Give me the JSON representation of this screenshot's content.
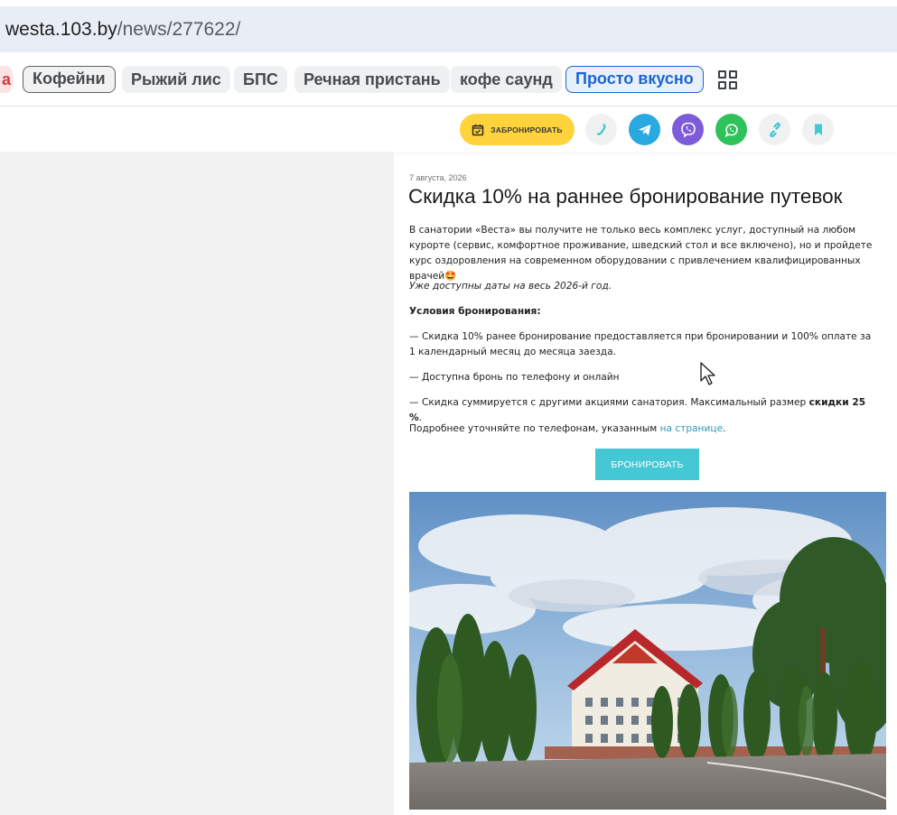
{
  "address_bar": {
    "domain": "westa.103.by",
    "path": "/news/277622/"
  },
  "chips": [
    {
      "label": "а"
    },
    {
      "label": "Кофейни"
    },
    {
      "label": "Рыжий лис"
    },
    {
      "label": "БПС"
    },
    {
      "label": "Речная пристань"
    },
    {
      "label": "кофе саунд"
    },
    {
      "label": "Просто вкусно"
    }
  ],
  "actions": {
    "book_label": "ЗАБРОНИРОВАТЬ",
    "icons": [
      "phone-icon",
      "telegram-icon",
      "viber-icon",
      "whatsapp-icon",
      "share-link-icon",
      "bookmark-icon"
    ],
    "colors": {
      "book": "#fed33c",
      "telegram": "#2aa8e0",
      "viber": "#7d5bd9",
      "whatsapp": "#2fc15a",
      "muted": "#f0f2f2",
      "accent": "#45c8d5"
    }
  },
  "article": {
    "date": "7 августа, 2026",
    "title": "Скидка 10% на раннее бронирование путевок",
    "intro": "В санатории «Веста» вы получите не только весь комплекс услуг, доступный на любом курорте (сервис, комфортное проживание, шведский стол и все включено), но и пройдете курс оздоровления на современном оборудовании с привлечением квалифицированных врачей🤩",
    "availability": "Уже доступны даты на весь 2026-й год.",
    "conditions_heading": "Условия бронирования:",
    "condition_1": "— Скидка 10% ранее бронирование предоставляется при бронировании и 100% оплате за 1 календарный месяц до месяца заезда.",
    "condition_2": "— Доступна бронь по телефону и онлайн",
    "condition_3_prefix": "— Скидка суммируется с другими акциями санатория. Максимальный размер ",
    "condition_3_bold": "скидки 25 %",
    "condition_3_suffix": ".",
    "details_prefix": "Подробнее уточняйте по телефонам, указанным ",
    "details_link": "на странице",
    "details_suffix": ".",
    "cta_label": "БРОНИРОВАТЬ"
  }
}
